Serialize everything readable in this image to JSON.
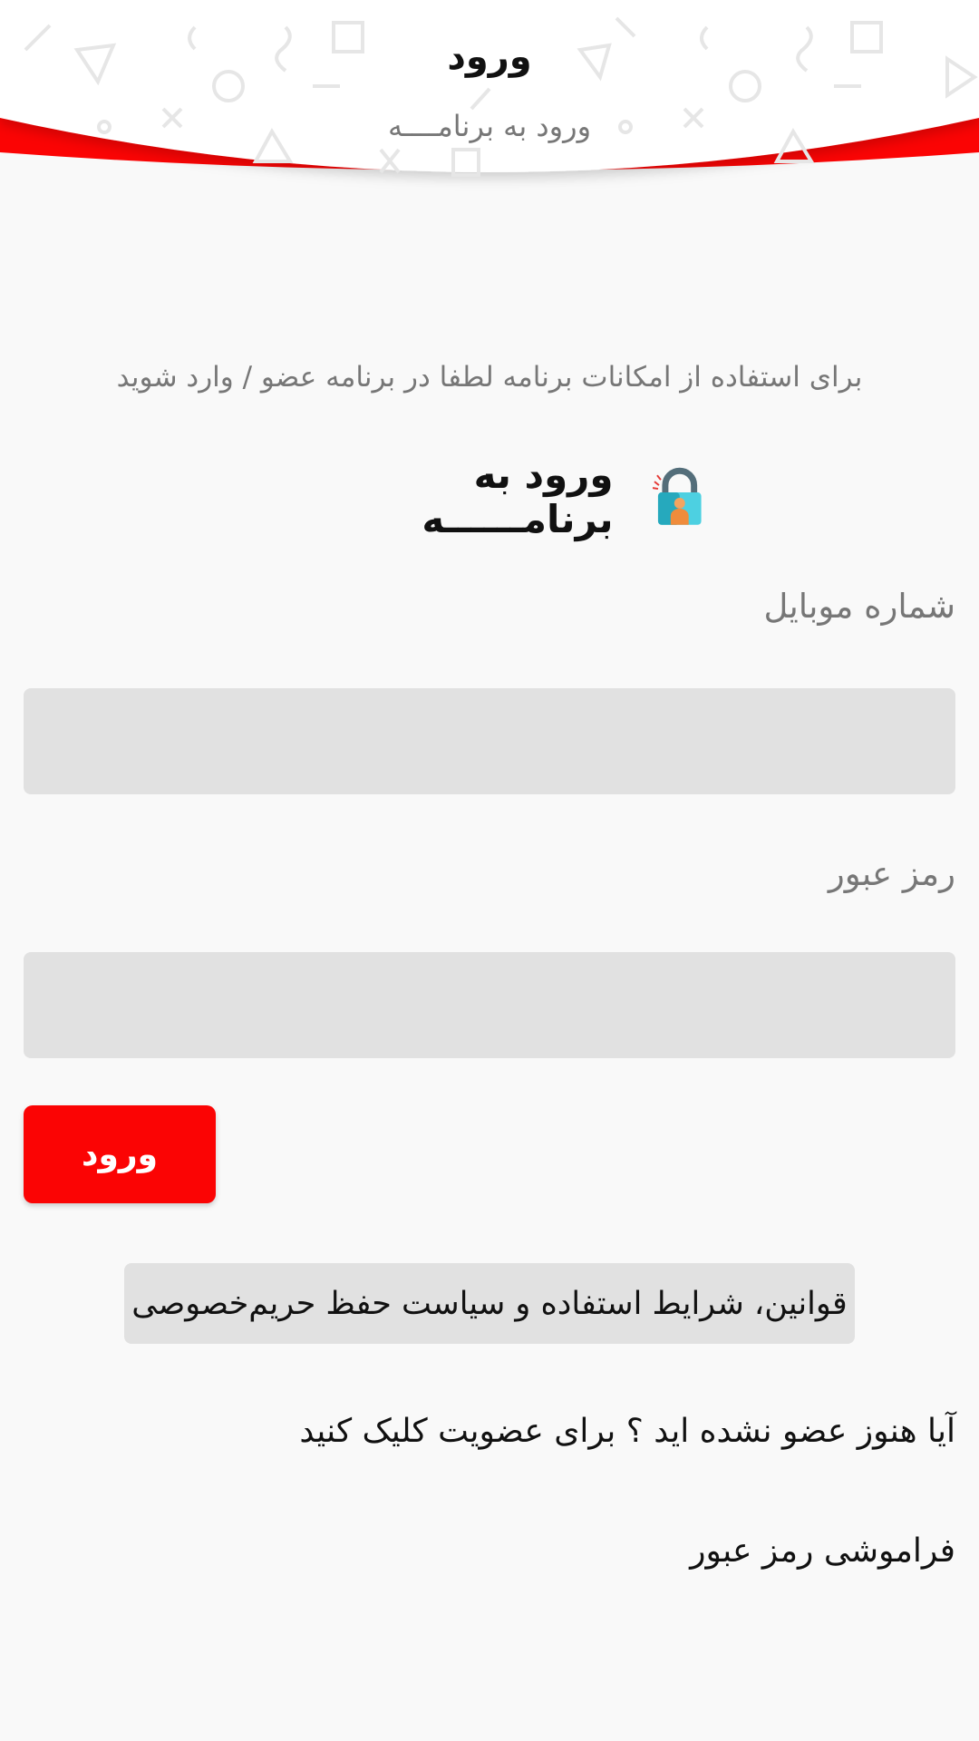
{
  "header": {
    "title": "ورود",
    "subtitle": "ورود به برنامــــه"
  },
  "intro_text": "برای استفاده از امکانات برنامه لطفا در برنامه عضو / وارد شوید",
  "login_heading": {
    "text": "ورود به برنامــــــه",
    "icon": "lock-user-icon"
  },
  "form": {
    "mobile_label": "شماره موبایل",
    "mobile_value": "",
    "password_label": "رمز عبور",
    "password_value": "",
    "submit_label": "ورود"
  },
  "terms_label": "قوانین، شرایط استفاده و سیاست حفظ حریم‌خصوصی",
  "signup_link": "آیا هنوز عضو نشده اید ؟ برای عضویت کلیک کنید",
  "forgot_link": "فراموشی رمز عبور",
  "colors": {
    "accent": "#fb0404",
    "background": "#f9f9f9",
    "input_bg": "#e1e1e1",
    "muted_text": "#777777"
  }
}
